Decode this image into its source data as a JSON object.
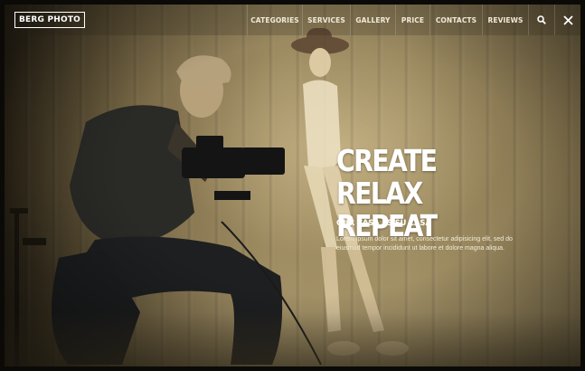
{
  "brand": {
    "logo_text": "BERG PHOTO"
  },
  "nav": {
    "items": [
      "CATEGORIES",
      "SERVICES",
      "GALLERY",
      "PRICE",
      "CONTACTS",
      "REVIEWS"
    ],
    "search_icon": "search-icon",
    "close_icon": "close-icon"
  },
  "hero": {
    "title_line1": "CREATE RELAX",
    "title_line2": "REPEAT",
    "subtitle": "OUR CASA ES SU CASA",
    "body_line1": "Lorem ipsum dolor sit amet, consectetur adipisicing elit, sed do",
    "body_line2": "eiusmod tempor incididunt ut labore et dolore magna aliqua."
  },
  "colors": {
    "text": "#ffffff",
    "nav_text": "#f1ead8",
    "photo_tint": "#a08f68"
  }
}
